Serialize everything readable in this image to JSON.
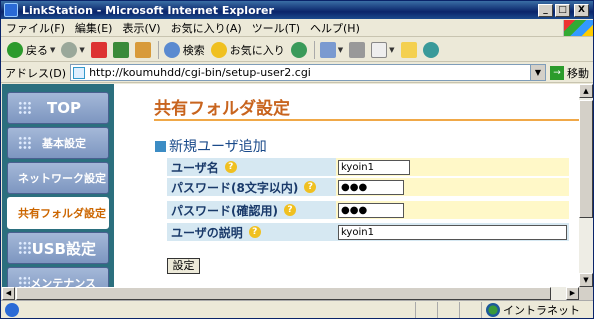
{
  "window": {
    "title": "LinkStation - Microsoft Internet Explorer",
    "minimize": "_",
    "maximize": "□",
    "close": "X"
  },
  "menu": [
    "ファイル(F)",
    "編集(E)",
    "表示(V)",
    "お気に入り(A)",
    "ツール(T)",
    "ヘルプ(H)"
  ],
  "toolbar": {
    "back": "戻る",
    "search": "検索",
    "favorites": "お気に入り"
  },
  "address": {
    "label": "アドレス(D)",
    "url": "http://koumuhdd/cgi-bin/setup-user2.cgi",
    "go": "移動"
  },
  "sidebar": {
    "items": [
      "TOP",
      "基本設定",
      "ネットワーク設定",
      "共有フォルダ設定",
      "USB設定",
      "メンテナンス"
    ],
    "active": "共有フォルダ設定"
  },
  "page": {
    "title": "共有フォルダ設定",
    "section": "新規ユーザ追加",
    "fields": [
      {
        "label": "ユーザ名",
        "value": "kyoin1"
      },
      {
        "label": "パスワード(8文字以内)",
        "value": "●●●"
      },
      {
        "label": "パスワード(確認用)",
        "value": "●●●"
      },
      {
        "label": "ユーザの説明",
        "value": "kyoin1"
      }
    ],
    "submit": "設定"
  },
  "status": {
    "zone": "イントラネット"
  },
  "colors": {
    "title_bar": "#0a246a",
    "sidebar": "#2b6f7e",
    "page_title": "#c8641e",
    "label_bg": "#d6e8f2",
    "value_bg": "#fff8c8"
  }
}
